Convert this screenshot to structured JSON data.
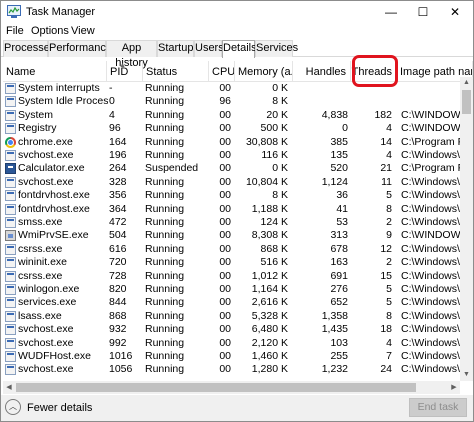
{
  "window": {
    "title": "Task Manager",
    "min": "—",
    "max": "☐",
    "close": "✕"
  },
  "menu": [
    "File",
    "Options",
    "View"
  ],
  "tabs": [
    "Processes",
    "Performance",
    "App history",
    "Startup",
    "Users",
    "Details",
    "Services"
  ],
  "active_tab": "Details",
  "columns": {
    "name": "Name",
    "pid": "PID",
    "status": "Status",
    "cpu": "CPU",
    "memory": "Memory (a...",
    "handles": "Handles",
    "threads": "Threads",
    "path": "Image path nam"
  },
  "highlight_color": "#e0141e",
  "rows": [
    {
      "icon": "window-icon",
      "name": "System interrupts",
      "pid": "-",
      "status": "Running",
      "cpu": "00",
      "mem": "0 K",
      "handles": "",
      "threads": ""
    },
    {
      "icon": "window-icon",
      "name": "System Idle Process",
      "pid": "0",
      "status": "Running",
      "cpu": "96",
      "mem": "8 K",
      "handles": "",
      "threads": ""
    },
    {
      "icon": "window-icon",
      "name": "System",
      "pid": "4",
      "status": "Running",
      "cpu": "00",
      "mem": "20 K",
      "handles": "4,838",
      "threads": "182",
      "path": "C:\\WINDOWS\\sy"
    },
    {
      "icon": "window-icon",
      "name": "Registry",
      "pid": "96",
      "status": "Running",
      "cpu": "00",
      "mem": "500 K",
      "handles": "0",
      "threads": "4",
      "path": "C:\\WINDOWS\\sy"
    },
    {
      "icon": "chrome-icon",
      "name": "chrome.exe",
      "pid": "164",
      "status": "Running",
      "cpu": "00",
      "mem": "30,808 K",
      "handles": "385",
      "threads": "14",
      "path": "C:\\Program File"
    },
    {
      "icon": "window-icon",
      "name": "svchost.exe",
      "pid": "196",
      "status": "Running",
      "cpu": "00",
      "mem": "116 K",
      "handles": "135",
      "threads": "4",
      "path": "C:\\Windows\\Sys"
    },
    {
      "icon": "calculator-icon",
      "name": "Calculator.exe",
      "pid": "264",
      "status": "Suspended",
      "cpu": "00",
      "mem": "0 K",
      "handles": "520",
      "threads": "21",
      "path": "C:\\Program File"
    },
    {
      "icon": "window-icon",
      "name": "svchost.exe",
      "pid": "328",
      "status": "Running",
      "cpu": "00",
      "mem": "10,804 K",
      "handles": "1,124",
      "threads": "11",
      "path": "C:\\Windows\\Sys"
    },
    {
      "icon": "window-icon",
      "name": "fontdrvhost.exe",
      "pid": "356",
      "status": "Running",
      "cpu": "00",
      "mem": "8 K",
      "handles": "36",
      "threads": "5",
      "path": "C:\\Windows\\Sys"
    },
    {
      "icon": "window-icon",
      "name": "fontdrvhost.exe",
      "pid": "364",
      "status": "Running",
      "cpu": "00",
      "mem": "1,188 K",
      "handles": "41",
      "threads": "8",
      "path": "C:\\Windows\\Sys"
    },
    {
      "icon": "window-icon",
      "name": "smss.exe",
      "pid": "472",
      "status": "Running",
      "cpu": "00",
      "mem": "124 K",
      "handles": "53",
      "threads": "2",
      "path": "C:\\Windows\\Sys"
    },
    {
      "icon": "wmi-icon",
      "name": "WmiPrvSE.exe",
      "pid": "504",
      "status": "Running",
      "cpu": "00",
      "mem": "8,308 K",
      "handles": "313",
      "threads": "9",
      "path": "C:\\WINDOWS\\sy"
    },
    {
      "icon": "window-icon",
      "name": "csrss.exe",
      "pid": "616",
      "status": "Running",
      "cpu": "00",
      "mem": "868 K",
      "handles": "678",
      "threads": "12",
      "path": "C:\\Windows\\Sys"
    },
    {
      "icon": "window-icon",
      "name": "wininit.exe",
      "pid": "720",
      "status": "Running",
      "cpu": "00",
      "mem": "516 K",
      "handles": "163",
      "threads": "2",
      "path": "C:\\Windows\\Sys"
    },
    {
      "icon": "window-icon",
      "name": "csrss.exe",
      "pid": "728",
      "status": "Running",
      "cpu": "00",
      "mem": "1,012 K",
      "handles": "691",
      "threads": "15",
      "path": "C:\\Windows\\Sys"
    },
    {
      "icon": "window-icon",
      "name": "winlogon.exe",
      "pid": "820",
      "status": "Running",
      "cpu": "00",
      "mem": "1,164 K",
      "handles": "276",
      "threads": "5",
      "path": "C:\\Windows\\Sys"
    },
    {
      "icon": "window-icon",
      "name": "services.exe",
      "pid": "844",
      "status": "Running",
      "cpu": "00",
      "mem": "2,616 K",
      "handles": "652",
      "threads": "5",
      "path": "C:\\Windows\\Sys"
    },
    {
      "icon": "window-icon",
      "name": "lsass.exe",
      "pid": "868",
      "status": "Running",
      "cpu": "00",
      "mem": "5,328 K",
      "handles": "1,358",
      "threads": "8",
      "path": "C:\\Windows\\Sys"
    },
    {
      "icon": "window-icon",
      "name": "svchost.exe",
      "pid": "932",
      "status": "Running",
      "cpu": "00",
      "mem": "6,480 K",
      "handles": "1,435",
      "threads": "18",
      "path": "C:\\Windows\\Sys"
    },
    {
      "icon": "window-icon",
      "name": "svchost.exe",
      "pid": "992",
      "status": "Running",
      "cpu": "00",
      "mem": "2,120 K",
      "handles": "103",
      "threads": "4",
      "path": "C:\\Windows\\Sys"
    },
    {
      "icon": "window-icon",
      "name": "WUDFHost.exe",
      "pid": "1016",
      "status": "Running",
      "cpu": "00",
      "mem": "1,460 K",
      "handles": "255",
      "threads": "7",
      "path": "C:\\Windows\\Sys"
    },
    {
      "icon": "window-icon",
      "name": "svchost.exe",
      "pid": "1056",
      "status": "Running",
      "cpu": "00",
      "mem": "1,280 K",
      "handles": "1,232",
      "threads": "24",
      "path": "C:\\Windows\\Sys"
    }
  ],
  "footer": {
    "fewer_details": "Fewer details",
    "end_task": "End task"
  }
}
